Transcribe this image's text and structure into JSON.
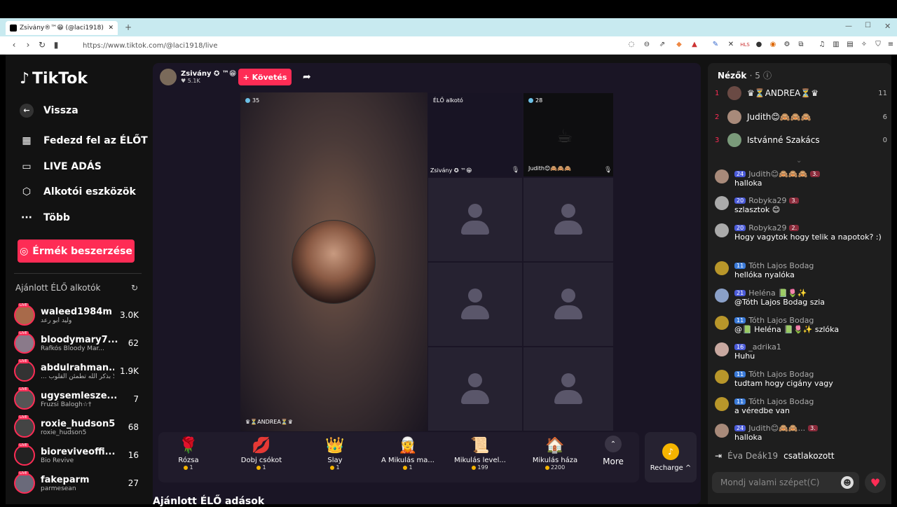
{
  "browser": {
    "tab_title": "Zsivány®™😁 (@laci1918) Él...",
    "url": "https://www.tiktok.com/@laci1918/live"
  },
  "sidebar": {
    "logo": "TikTok",
    "back": "Vissza",
    "items": [
      {
        "icon": "live-discover-icon",
        "label": "Fedezd fel az ÉLŐT"
      },
      {
        "icon": "video-camera-icon",
        "label": "LIVE ADÁS"
      },
      {
        "icon": "creator-tools-icon",
        "label": "Alkotói eszközök"
      },
      {
        "icon": "more-dots-icon",
        "label": "Több"
      }
    ],
    "coins_button": "Érmék beszerzése",
    "recommended_title": "Ajánlott ÉLŐ alkotók",
    "creators": [
      {
        "name": "waleed1984m",
        "sub": "وليد ابو رعد",
        "count": "3.0K"
      },
      {
        "name": "bloodymary7...",
        "sub": "Rafkós Bloody Mar...",
        "count": "62"
      },
      {
        "name": "abdulrahman...",
        "sub": "... الا بذكر الله تطمئن القلوب",
        "count": "1.9K"
      },
      {
        "name": "ugysemlesze...",
        "sub": "Fruzsi Balogh☆†",
        "count": "7"
      },
      {
        "name": "roxie_hudson5",
        "sub": "roxie_hudson5",
        "count": "68"
      },
      {
        "name": "bioreviveoffi...",
        "sub": "Bio Revive",
        "count": "16"
      },
      {
        "name": "fakeparm",
        "sub": "parmesean",
        "count": "27"
      }
    ]
  },
  "stream": {
    "host_name": "Zsivány ✪ ™😁",
    "host_likes": "5.1K",
    "follow": "+ Követés",
    "main_viewers": "35",
    "main_guest": "♛⏳ANDREA⏳♛",
    "guest_tag": "ÉLŐ alkotó",
    "guest_host_name": "Zsivány ✪ ™😁",
    "guest2_viewers": "28",
    "guest2_name": "Judith😊🙈🙈🙈"
  },
  "gifts": [
    {
      "icon": "🌹",
      "name": "Rózsa",
      "price": "1"
    },
    {
      "icon": "💋",
      "name": "Dobj csókot",
      "price": "1"
    },
    {
      "icon": "👑",
      "name": "Slay",
      "price": "1"
    },
    {
      "icon": "🧝",
      "name": "A Mikulás ma...",
      "price": "1"
    },
    {
      "icon": "📜",
      "name": "Mikulás level...",
      "price": "199"
    },
    {
      "icon": "🏠",
      "name": "Mikulás háza",
      "price": "2200"
    }
  ],
  "more": "More",
  "recharge": "Recharge ^",
  "bottom_title": "Ajánlott ÉLŐ adások",
  "chat": {
    "viewers_title": "Nézők",
    "viewers_count": "· 5",
    "viewers": [
      {
        "rank": "1",
        "name": "♛⏳ANDREA⏳♛",
        "count": "11"
      },
      {
        "rank": "2",
        "name": "Judith😊🙈🙈🙈",
        "count": "6"
      },
      {
        "rank": "3",
        "name": "Istvánné Szakács",
        "count": "0"
      }
    ],
    "messages": [
      {
        "level": "24",
        "user": "Judith😊🙈🙈🙈",
        "fan": "3.",
        "text": "halloka"
      },
      {
        "level": "20",
        "user": "Robyka29",
        "fan": "3.",
        "text": "szlasztok 😊"
      },
      {
        "level": "20",
        "user": "Robyka29",
        "fan": "2.",
        "text": "Hogy vagytok hogy telik a napotok? :)"
      },
      {
        "level": "11",
        "user": "Tóth Lajos Bodag",
        "fan": "",
        "text": "hellóka nyalóka"
      },
      {
        "level": "21",
        "user": "Heléna 📗🌷✨",
        "fan": "",
        "text": "@Tóth Lajos Bodag szia"
      },
      {
        "level": "11",
        "user": "Tóth Lajos Bodag",
        "fan": "",
        "text": "@📗 Heléna 📗🌷✨ szlóka"
      },
      {
        "level": "16",
        "user": "_adrika1",
        "fan": "",
        "text": "Huhu"
      },
      {
        "level": "11",
        "user": "Tóth Lajos Bodag",
        "fan": "",
        "text": "tudtam hogy cigány vagy"
      },
      {
        "level": "11",
        "user": "Tóth Lajos Bodag",
        "fan": "",
        "text": "a véredbe van"
      },
      {
        "level": "24",
        "user": "Judith😊🙈🙈...",
        "fan": "3.",
        "text": "halloka"
      }
    ],
    "joined_user": "Éva Deák19",
    "joined_text": "csatlakozott",
    "input_placeholder": "Mondj valami szépet(C)"
  }
}
